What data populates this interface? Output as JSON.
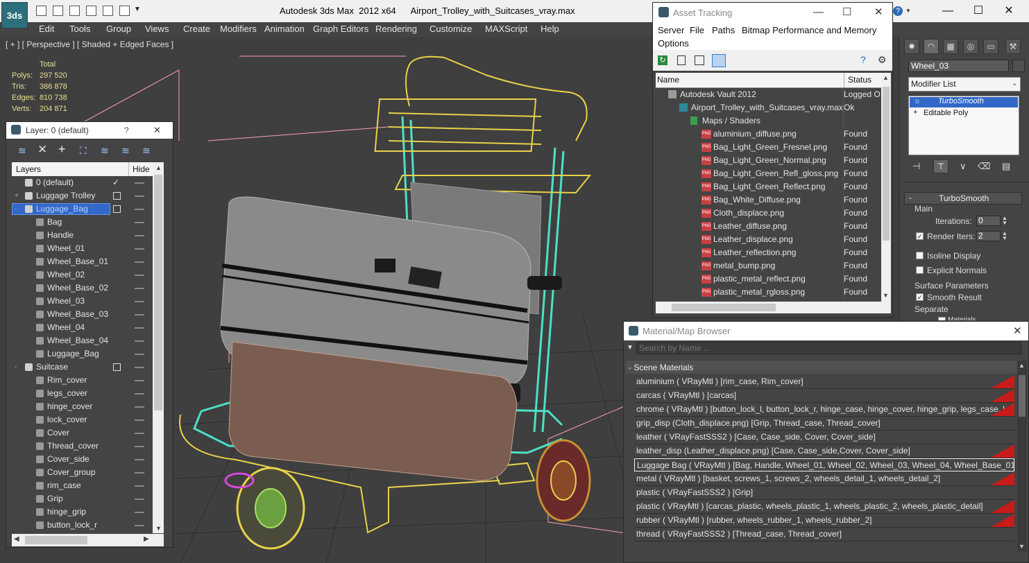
{
  "window": {
    "title_text": "Autodesk 3ds Max  2012 x64      Airport_Trolley_with_Suitcases_vray.max",
    "app_logo": "3ds",
    "help_icon": "?"
  },
  "menu": [
    "Edit",
    "Tools",
    "Group",
    "Views",
    "Create",
    "Modifiers",
    "Animation",
    "Graph Editors",
    "Rendering",
    "Customize",
    "MAXScript",
    "Help"
  ],
  "viewport": {
    "label": "[ + ] [ Perspective ] [ Shaded + Edged Faces ]",
    "stats": {
      "header": "Total",
      "rows": [
        {
          "label": "Polys:",
          "value": "297 520"
        },
        {
          "label": "Tris:",
          "value": "386 878"
        },
        {
          "label": "Edges:",
          "value": "810 738"
        },
        {
          "label": "Verts:",
          "value": "204 871"
        }
      ]
    }
  },
  "layer_panel": {
    "title": "Layer: 0 (default)",
    "help": "?",
    "close": "✕",
    "col_layers": "Layers",
    "col_hide": "Hide",
    "rows": [
      {
        "label": "0 (default)",
        "level": 0,
        "toggle": "",
        "check": "✓"
      },
      {
        "label": "Luggage Trolley",
        "level": 0,
        "toggle": "+",
        "check": ""
      },
      {
        "label": "Luggage_Bag",
        "level": 0,
        "toggle": "-",
        "check": "",
        "selected": true
      },
      {
        "label": "Bag",
        "level": 1
      },
      {
        "label": "Handle",
        "level": 1
      },
      {
        "label": "Wheel_01",
        "level": 1
      },
      {
        "label": "Wheel_Base_01",
        "level": 1
      },
      {
        "label": "Wheel_02",
        "level": 1
      },
      {
        "label": "Wheel_Base_02",
        "level": 1
      },
      {
        "label": "Wheel_03",
        "level": 1
      },
      {
        "label": "Wheel_Base_03",
        "level": 1
      },
      {
        "label": "Wheel_04",
        "level": 1
      },
      {
        "label": "Wheel_Base_04",
        "level": 1
      },
      {
        "label": "Luggage_Bag",
        "level": 1
      },
      {
        "label": "Suitcase",
        "level": 0,
        "toggle": "-",
        "check": ""
      },
      {
        "label": "Rim_cover",
        "level": 1
      },
      {
        "label": "legs_cover",
        "level": 1
      },
      {
        "label": "hinge_cover",
        "level": 1
      },
      {
        "label": "lock_cover",
        "level": 1
      },
      {
        "label": "Cover",
        "level": 1
      },
      {
        "label": "Thread_cover",
        "level": 1
      },
      {
        "label": "Cover_side",
        "level": 1
      },
      {
        "label": "Cover_group",
        "level": 1
      },
      {
        "label": "rim_case",
        "level": 1
      },
      {
        "label": "Grip",
        "level": 1
      },
      {
        "label": "hinge_grip",
        "level": 1
      },
      {
        "label": "button_lock_r",
        "level": 1
      }
    ]
  },
  "asset_tracking": {
    "title": "Asset Tracking",
    "menu_row1": [
      "Server",
      "File",
      "Paths",
      "Bitmap Performance and Memory"
    ],
    "menu_row2": [
      "Options"
    ],
    "col_name": "Name",
    "col_status": "Status",
    "rows": [
      {
        "name": "Autodesk Vault 2012",
        "status": "Logged O",
        "indent": 18,
        "icon": "vault"
      },
      {
        "name": "Airport_Trolley_with_Suitcases_vray.max",
        "status": "Ok",
        "indent": 34,
        "icon": "max"
      },
      {
        "name": "Maps / Shaders",
        "status": "",
        "indent": 50,
        "icon": "maps"
      },
      {
        "name": "aluminium_diffuse.png",
        "status": "Found",
        "indent": 66,
        "icon": "png"
      },
      {
        "name": "Bag_Light_Green_Fresnel.png",
        "status": "Found",
        "indent": 66,
        "icon": "png"
      },
      {
        "name": "Bag_Light_Green_Normal.png",
        "status": "Found",
        "indent": 66,
        "icon": "png"
      },
      {
        "name": "Bag_Light_Green_Refl_gloss.png",
        "status": "Found",
        "indent": 66,
        "icon": "png"
      },
      {
        "name": "Bag_Light_Green_Reflect.png",
        "status": "Found",
        "indent": 66,
        "icon": "png"
      },
      {
        "name": "Bag_White_Diffuse.png",
        "status": "Found",
        "indent": 66,
        "icon": "png"
      },
      {
        "name": "Cloth_displace.png",
        "status": "Found",
        "indent": 66,
        "icon": "png"
      },
      {
        "name": "Leather_diffuse.png",
        "status": "Found",
        "indent": 66,
        "icon": "png"
      },
      {
        "name": "Leather_displace.png",
        "status": "Found",
        "indent": 66,
        "icon": "png"
      },
      {
        "name": "Leather_reflection.png",
        "status": "Found",
        "indent": 66,
        "icon": "png"
      },
      {
        "name": "metal_bump.png",
        "status": "Found",
        "indent": 66,
        "icon": "png"
      },
      {
        "name": "plastic_metal_reflect.png",
        "status": "Found",
        "indent": 66,
        "icon": "png"
      },
      {
        "name": "plastic_metal_rgloss.png",
        "status": "Found",
        "indent": 66,
        "icon": "png"
      }
    ]
  },
  "material_browser": {
    "title": "Material/Map Browser",
    "search_placeholder": "Search by Name ...",
    "section": "- Scene Materials",
    "rows": [
      {
        "text": "aluminium  ( VRayMtl ) [rim_case, Rim_cover]",
        "tri": true
      },
      {
        "text": "carcas  ( VRayMtl ) [carcas]",
        "tri": true
      },
      {
        "text": "chrome  ( VRayMtl ) [button_lock_l, button_lock_r, hinge_case, hinge_cover, hinge_grip, legs_case, legs_...",
        "tri": true
      },
      {
        "text": "grip_disp (Cloth_displace.png) [Grip, Thread_case, Thread_cover]",
        "tri": false
      },
      {
        "text": "leather  ( VRayFastSSS2 ) [Case, Case_side, Cover, Cover_side]",
        "tri": false
      },
      {
        "text": "leather_disp (Leather_displace.png) [Case, Case_side,Cover, Cover_side]",
        "tri": true
      },
      {
        "text": "Luggage Bag  ( VRayMtl )  [Bag, Handle, Wheel_01, Wheel_02, Wheel_03, Wheel_04, Wheel_Base_01, W...",
        "tri": false,
        "selected": true
      },
      {
        "text": "metal  ( VRayMtl ) [basket, screws_1, screws_2, wheels_detail_1, wheels_detail_2]",
        "tri": true
      },
      {
        "text": "plastic  ( VRayFastSSS2 ) [Grip]",
        "tri": false
      },
      {
        "text": "plastic  ( VRayMtl ) [carcas_plastic, wheels_plastic_1, wheels_plastic_2, wheels_plastic_detail]",
        "tri": true
      },
      {
        "text": "rubber  ( VRayMtl ) [rubber, wheels_rubber_1, wheels_rubber_2]",
        "tri": true
      },
      {
        "text": "thread  ( VRayFastSSS2 ) [Thread_case, Thread_cover]",
        "tri": false
      }
    ]
  },
  "command_panel": {
    "object_name": "Wheel_03",
    "modifier_list": "Modifier List",
    "stack": [
      {
        "label": "TurboSmooth",
        "selected": true
      },
      {
        "label": "Editable Poly",
        "selected": false
      }
    ],
    "rollout_title": "TurboSmooth",
    "main_label": "Main",
    "iterations_label": "Iterations:",
    "iterations_value": "0",
    "render_iters_label": "Render Iters:",
    "render_iters_value": "2",
    "isoline_label": "Isoline Display",
    "explicit_label": "Explicit Normals",
    "surface_label": "Surface Parameters",
    "smooth_label": "Smooth Result",
    "separate_label": "Separate",
    "materials_label": "Materials"
  },
  "colors": {
    "wire_yellow": "#e8d24a",
    "wire_cyan": "#4de0c8",
    "wire_white": "#c9c9c9",
    "wire_pink": "#ffb6c8",
    "selection_blue": "#3268c8",
    "material_triangle": "#c81b1b",
    "stats_text": "#e8e090"
  }
}
